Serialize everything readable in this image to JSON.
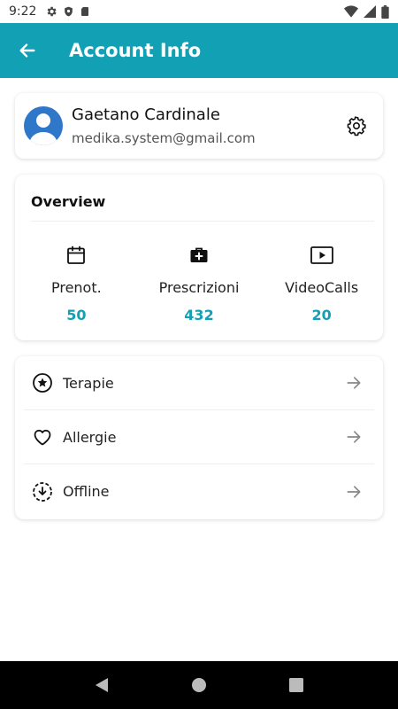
{
  "status_bar": {
    "time": "9:22",
    "left_icons": [
      "gear-icon",
      "shield-icon",
      "sd-card-icon"
    ],
    "right_icons": [
      "wifi-icon",
      "signal-icon",
      "battery-icon"
    ]
  },
  "app_bar": {
    "title": "Account Info",
    "background": "#12a0b4"
  },
  "profile": {
    "name": "Gaetano Cardinale",
    "email": "medika.system@gmail.com"
  },
  "overview": {
    "title": "Overview",
    "stats": [
      {
        "icon": "calendar-icon",
        "label": "Prenot.",
        "value": "50"
      },
      {
        "icon": "medical-kit-icon",
        "label": "Prescrizioni",
        "value": "432"
      },
      {
        "icon": "video-play-icon",
        "label": "VideoCalls",
        "value": "20"
      }
    ]
  },
  "menu": {
    "items": [
      {
        "icon": "star-circle-icon",
        "label": "Terapie"
      },
      {
        "icon": "heart-icon",
        "label": "Allergie"
      },
      {
        "icon": "download-circle-icon",
        "label": "Offline"
      }
    ]
  },
  "nav_bar": {
    "buttons": [
      "back-triangle-icon",
      "home-circle-icon",
      "recents-square-icon"
    ]
  },
  "colors": {
    "accent": "#12a0b4",
    "avatar_bg": "#2f77c8"
  }
}
